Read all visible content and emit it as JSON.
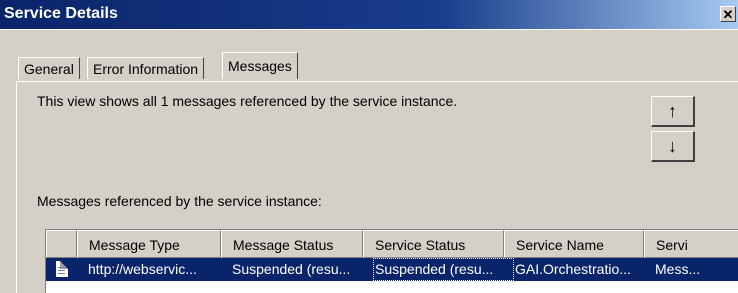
{
  "window": {
    "title": "Service Details",
    "close_label": "✕"
  },
  "tabs": [
    {
      "label": "General",
      "active": false
    },
    {
      "label": "Error Information",
      "active": false
    },
    {
      "label": "Messages",
      "active": true
    }
  ],
  "messages_tab": {
    "description": "This view shows all 1 messages referenced by the service instance.",
    "move_up_icon": "↑",
    "move_down_icon": "↓",
    "list_caption": "Messages referenced by the service instance:"
  },
  "list": {
    "columns": [
      "",
      "Message Type",
      "Message Status",
      "Service Status",
      "Service Name",
      "Servi"
    ],
    "rows": [
      {
        "icon": "document-icon",
        "message_type": "http://webservic...",
        "message_status": "Suspended (resu...",
        "service_status": "Suspended (resu...",
        "service_name": "GAI.Orchestratio...",
        "service_class": "Mess..."
      }
    ]
  },
  "colors": {
    "titlebar": "#0a246a",
    "selection": "#0a246a",
    "face": "#d4d0c8"
  }
}
